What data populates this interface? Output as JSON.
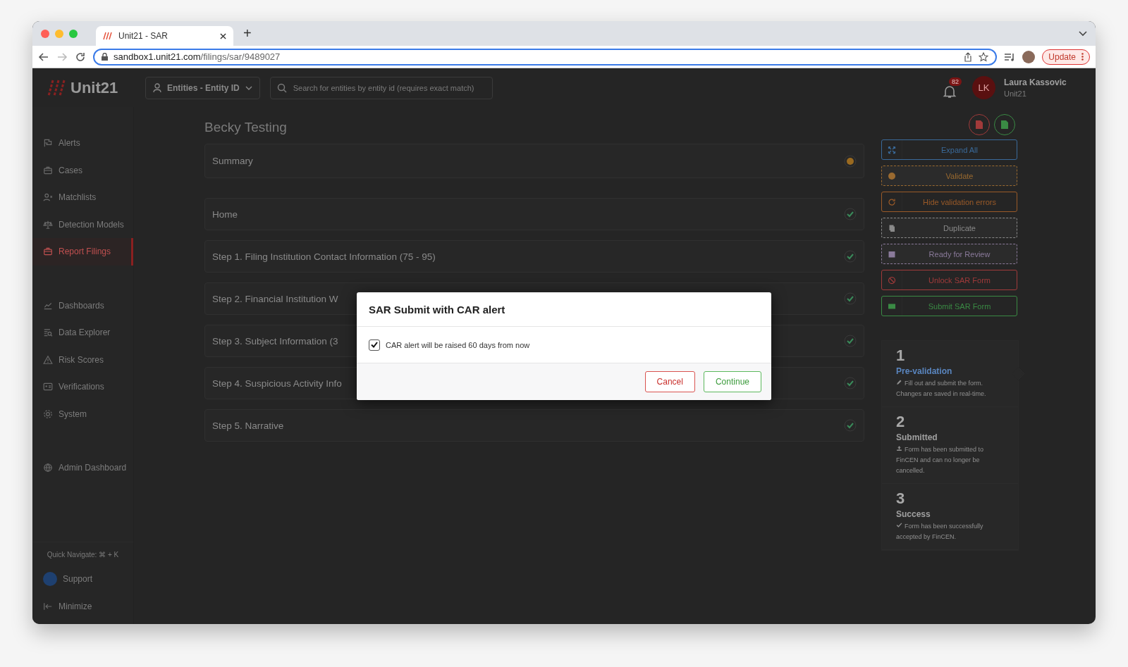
{
  "browser": {
    "tab": {
      "title": "Unit21 - SAR",
      "selected": true
    },
    "new_tab": "+",
    "url_host": "sandbox1.unit21.com",
    "url_path": "/filings/sar/9489027",
    "update_button": "Update"
  },
  "header": {
    "logo": "Unit21",
    "entity_dropdown": "Entities - Entity ID",
    "search": {
      "placeholder": "Search for entities by entity id (requires exact match)"
    },
    "notifications": "82",
    "user": {
      "initials": "LK",
      "name": "Laura Kassovic",
      "org": "Unit21"
    }
  },
  "sidebar": {
    "groups": [
      {
        "items": [
          {
            "label": "Alerts",
            "selected": false
          },
          {
            "label": "Cases",
            "selected": false
          },
          {
            "label": "Matchlists",
            "selected": false
          },
          {
            "label": "Detection Models",
            "selected": false
          },
          {
            "label": "Report Filings",
            "selected": true
          }
        ]
      },
      {
        "items": [
          {
            "label": "Dashboards",
            "selected": false
          },
          {
            "label": "Data Explorer",
            "selected": false
          },
          {
            "label": "Risk Scores",
            "selected": false
          },
          {
            "label": "Verifications",
            "selected": false
          },
          {
            "label": "System",
            "selected": false
          }
        ]
      },
      {
        "items": [
          {
            "label": "Admin Dashboard",
            "selected": false
          }
        ]
      }
    ],
    "quick_navigate": "Quick Navigate: ⌘ + K",
    "support": "Support",
    "minimize": "Minimize"
  },
  "page": {
    "title": "Becky Testing",
    "sections": [
      {
        "label": "Summary",
        "kind": "warning"
      },
      {
        "label": "Home",
        "kind": "done"
      },
      {
        "label": "Step 1. Filing Institution Contact Information (75 - 95)",
        "kind": "done"
      },
      {
        "label": "Step 2. Financial Institution W",
        "kind": "done"
      },
      {
        "label": "Step 3. Subject Information (3",
        "kind": "done"
      },
      {
        "label": "Step 4. Suspicious Activity Info",
        "kind": "done"
      },
      {
        "label": "Step 5. Narrative",
        "kind": "done"
      }
    ]
  },
  "actions": [
    {
      "label": "Expand All",
      "color": "#3a6a9a",
      "disabled": false
    },
    {
      "label": "Validate",
      "color": "#9a6a30",
      "disabled": true
    },
    {
      "label": "Hide validation errors",
      "color": "#9a5a28",
      "disabled": false
    },
    {
      "label": "Duplicate",
      "color": "#8a8a8a",
      "disabled": true
    },
    {
      "label": "Ready for Review",
      "color": "#8a7a9a",
      "disabled": true
    },
    {
      "label": "Unlock SAR Form",
      "color": "#a03a3a",
      "disabled": false
    },
    {
      "label": "Submit SAR Form",
      "color": "#3a8a44",
      "disabled": false
    }
  ],
  "progress": [
    {
      "number": "1",
      "title": "Pre-validation",
      "text": "Fill out and submit the form. Changes are saved in real-time.",
      "selected": true
    },
    {
      "number": "2",
      "title": "Submitted",
      "text": "Form has been submitted to FinCEN and can no longer be cancelled.",
      "selected": false
    },
    {
      "number": "3",
      "title": "Success",
      "text": "Form has been successfully accepted by FinCEN.",
      "selected": false
    }
  ],
  "dialog": {
    "title": "SAR Submit with CAR alert",
    "checkbox": {
      "label": "CAR alert will be raised 60 days from now",
      "checked": true
    },
    "buttons": [
      {
        "label": "Cancel",
        "kind": "cancel"
      },
      {
        "label": "Continue",
        "kind": "confirm"
      }
    ]
  }
}
